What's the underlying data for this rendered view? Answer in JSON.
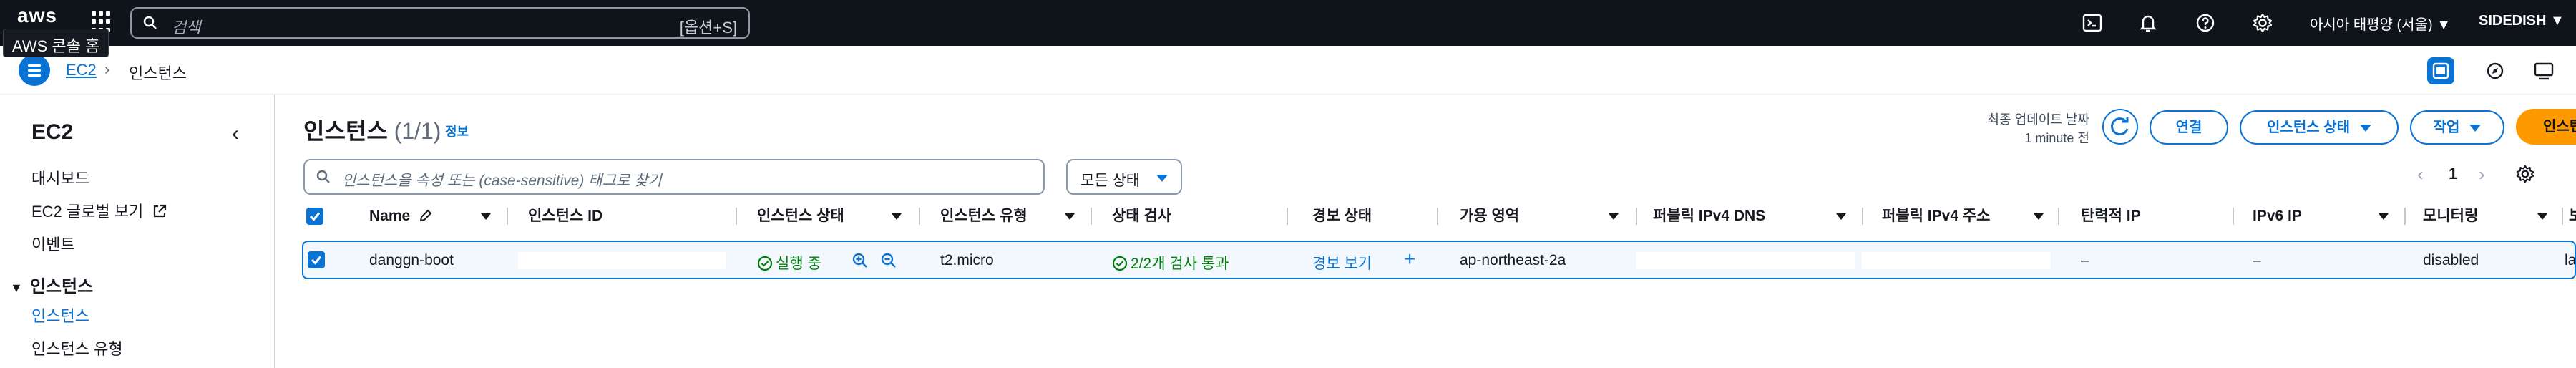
{
  "topnav": {
    "logo_text": "aws",
    "tooltip": "AWS 콘솔 홈",
    "search_placeholder": "검색",
    "search_shortcut": "[옵션+S]",
    "region": "아시아 태평양 (서울) ▼",
    "account": "SIDEDISH ▼",
    "icons": [
      "services-grid-icon",
      "cloudshell-icon",
      "bell-icon",
      "help-icon",
      "gear-icon"
    ]
  },
  "breadcrumb": {
    "parent": "EC2",
    "separator": "›",
    "current": "인스턴스"
  },
  "sidebar": {
    "title": "EC2",
    "items": [
      {
        "label": "대시보드"
      },
      {
        "label": "EC2 글로벌 보기"
      },
      {
        "label": "이벤트"
      }
    ],
    "section": "인스턴스",
    "section_items": [
      {
        "label": "인스턴스"
      },
      {
        "label": "인스턴스 유형"
      }
    ]
  },
  "main": {
    "title": "인스턴스",
    "count": "(1/1)",
    "info": "정보",
    "last_updated_label": "최종 업데이트 날짜",
    "last_updated_value": "1 minute 전",
    "buttons": {
      "connect": "연결",
      "instance_state": "인스턴스 상태",
      "actions": "작업",
      "launch": "인스턴스 시작"
    },
    "filter_placeholder": "인스턴스을 속성 또는 (case-sensitive) 태그로 찾기",
    "state_filter": "모든 상태",
    "page": "1"
  },
  "table": {
    "columns": [
      "Name",
      "인스턴스 ID",
      "인스턴스 상태",
      "인스턴스 유형",
      "상태 검사",
      "경보 상태",
      "가용 영역",
      "퍼블릭 IPv4 DNS",
      "퍼블릭 IPv4 주소",
      "탄력적 IP",
      "IPv6 IP",
      "모니터링",
      "보안"
    ],
    "rows": [
      {
        "name": "danggn-boot",
        "instance_id": "",
        "state": "실행 중",
        "type": "t2.micro",
        "status_check": "2/2개 검사 통과",
        "alarm": "경보 보기",
        "az": "ap-northeast-2a",
        "public_dns": "",
        "public_ip": "",
        "elastic_ip": "–",
        "ipv6": "–",
        "monitoring": "disabled",
        "security": "lau"
      }
    ]
  },
  "colors": {
    "nav_bg": "#0f141a",
    "accent": "#0972d3",
    "primary": "#ff9900",
    "success": "#037f0c"
  }
}
